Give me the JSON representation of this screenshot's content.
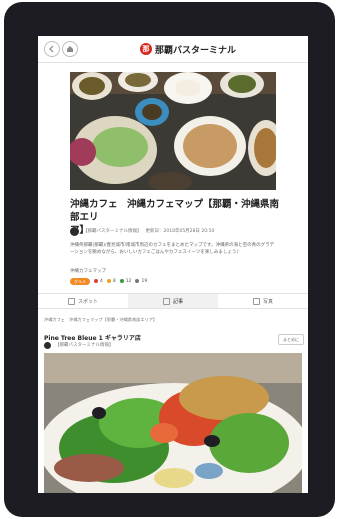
{
  "app": {
    "name": "那覇バスターミナル",
    "logo_text": "那"
  },
  "header": {
    "back_icon": "back-arrow-icon",
    "home_icon": "home-icon"
  },
  "article": {
    "title_line1": "沖縄カフェ　沖縄カフェマップ【那覇・沖縄県南部エリ",
    "title_line2": "ア】",
    "author": "【那覇バスターミナル情報】",
    "updated": "更新日：2018年05月28日 20:50",
    "description": "沖縄県那覇(那覇)/豊見城市/南城市周辺のカフェをまとめたマップです。沖縄県の海と空の青のグラデーションを眺めながら、おいしいカフェごはんやカフェスイーツを楽しみましょう♪",
    "tag": "沖縄カフェマップ",
    "badge": "グルメ",
    "stats": [
      {
        "value": "4",
        "color": "#e23b3b"
      },
      {
        "value": "8",
        "color": "#f0a21d"
      },
      {
        "value": "12",
        "color": "#2f9e3d"
      },
      {
        "value": "19",
        "color": "#777777"
      }
    ]
  },
  "tabs": [
    {
      "label": "スポット"
    },
    {
      "label": "記事"
    },
    {
      "label": "写真"
    }
  ],
  "spot": {
    "breadcrumb": "沖縄カフェ　沖縄カフェマップ【那覇・沖縄県南部エリア】",
    "title": "Pine Tree Bleue 1 ギャラリア店",
    "author": "【那覇バスターミナル情報】",
    "save_label": "まとめに"
  }
}
